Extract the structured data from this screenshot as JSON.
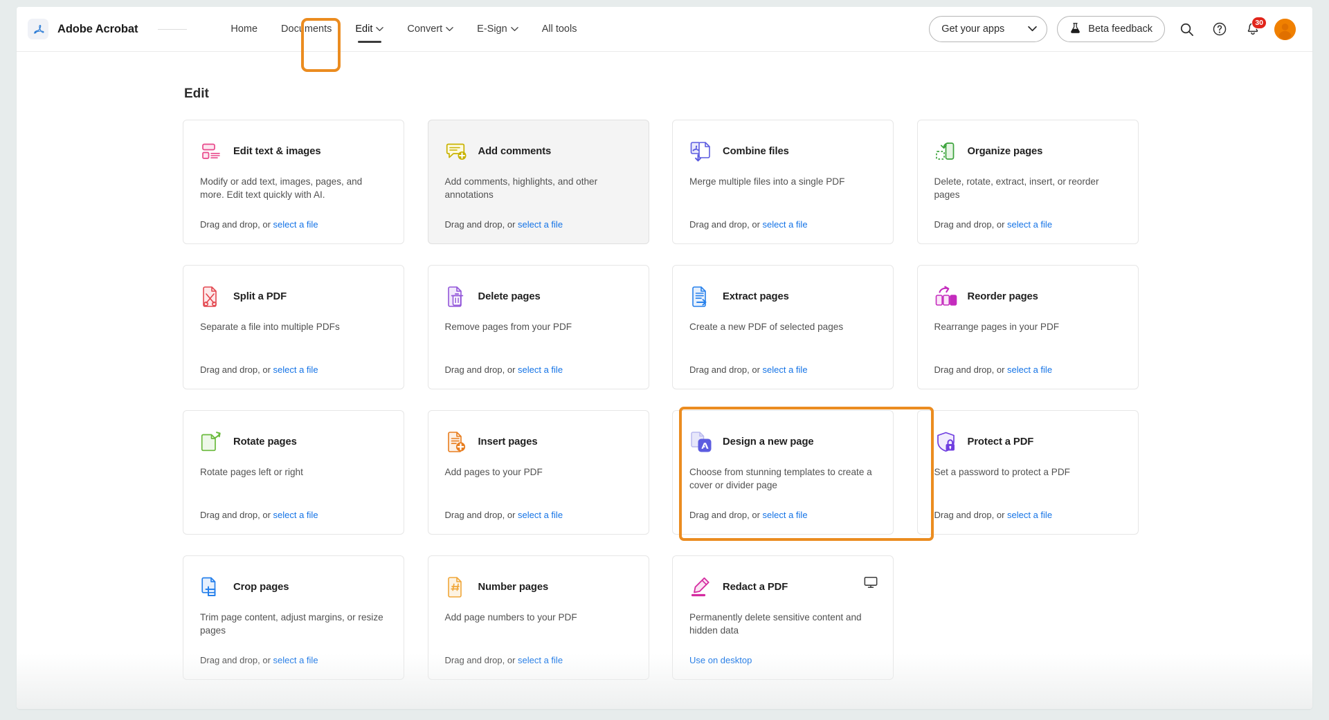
{
  "header": {
    "brand": {
      "logo_icon": "acrobat-logo-icon",
      "name": "Adobe Acrobat"
    },
    "nav": [
      {
        "label": "Home",
        "has_caret": false,
        "active": false
      },
      {
        "label": "Documents",
        "has_caret": false,
        "active": false
      },
      {
        "label": "Edit",
        "has_caret": true,
        "active": true
      },
      {
        "label": "Convert",
        "has_caret": true,
        "active": false
      },
      {
        "label": "E-Sign",
        "has_caret": true,
        "active": false
      },
      {
        "label": "All tools",
        "has_caret": false,
        "active": false
      }
    ],
    "get_apps_label": "Get your apps",
    "beta_feedback_label": "Beta feedback",
    "search_icon": "search-icon",
    "help_icon": "help-circle-icon",
    "notifications_icon": "bell-icon",
    "notifications_count": "30",
    "avatar_icon": "user-avatar-icon"
  },
  "main": {
    "title": "Edit",
    "drag_prefix": "Drag and drop, or ",
    "select_file_label": "select a file",
    "cards": [
      {
        "title": "Edit text & images",
        "desc": "Modify or add text, images, pages, and more. Edit text quickly with AI.",
        "icon": "edit-text-images-icon",
        "color": "#e8488b",
        "action": "drag",
        "hovered": false
      },
      {
        "title": "Add comments",
        "desc": "Add comments, highlights, and other annotations",
        "icon": "add-comments-icon",
        "color": "#c8b200",
        "action": "drag",
        "hovered": true
      },
      {
        "title": "Combine files",
        "desc": "Merge multiple files into a single PDF",
        "icon": "combine-files-icon",
        "color": "#5c5ce0",
        "action": "drag",
        "hovered": false
      },
      {
        "title": "Organize pages",
        "desc": "Delete, rotate, extract, insert, or reorder pages",
        "icon": "organize-pages-icon",
        "color": "#3ba33b",
        "action": "drag",
        "hovered": false
      },
      {
        "title": "Split a PDF",
        "desc": "Separate a file into multiple PDFs",
        "icon": "split-pdf-icon",
        "color": "#e34850",
        "action": "drag",
        "hovered": false
      },
      {
        "title": "Delete pages",
        "desc": "Remove pages from your PDF",
        "icon": "delete-pages-icon",
        "color": "#9256d9",
        "action": "drag",
        "hovered": false
      },
      {
        "title": "Extract pages",
        "desc": "Create a new PDF of selected pages",
        "icon": "extract-pages-icon",
        "color": "#2680eb",
        "action": "drag",
        "hovered": false
      },
      {
        "title": "Reorder pages",
        "desc": "Rearrange pages in your PDF",
        "icon": "reorder-pages-icon",
        "color": "#c42bbd",
        "action": "drag",
        "hovered": false
      },
      {
        "title": "Rotate pages",
        "desc": "Rotate pages left or right",
        "icon": "rotate-pages-icon",
        "color": "#6aba3c",
        "action": "drag",
        "hovered": false
      },
      {
        "title": "Insert pages",
        "desc": "Add pages to your PDF",
        "icon": "insert-pages-icon",
        "color": "#e87d1e",
        "action": "drag",
        "hovered": false
      },
      {
        "title": "Design a new page",
        "desc": "Choose from stunning templates to create a cover or divider page",
        "icon": "design-new-page-icon",
        "color": "#5c5ce0",
        "action": "drag",
        "hovered": false,
        "highlighted": true
      },
      {
        "title": "Protect a PDF",
        "desc": "Set a password to protect a PDF",
        "icon": "protect-pdf-icon",
        "color": "#6f3ee0",
        "action": "drag",
        "hovered": false
      },
      {
        "title": "Crop pages",
        "desc": "Trim page content, adjust margins, or resize pages",
        "icon": "crop-pages-icon",
        "color": "#2680eb",
        "action": "drag",
        "hovered": false
      },
      {
        "title": "Number pages",
        "desc": "Add page numbers to your PDF",
        "icon": "number-pages-icon",
        "color": "#f0a73a",
        "action": "drag",
        "hovered": false
      },
      {
        "title": "Redact a PDF",
        "desc": "Permanently delete sensitive content and hidden data",
        "icon": "redact-pdf-icon",
        "color": "#d42ba0",
        "action": "desktop",
        "desktop_label": "Use on desktop",
        "desktop_icon": "monitor-icon",
        "hovered": false
      }
    ]
  },
  "annotations": {
    "color": "#eb8c20",
    "targets": [
      "edit-nav-tab",
      "design-a-new-page-card"
    ]
  }
}
